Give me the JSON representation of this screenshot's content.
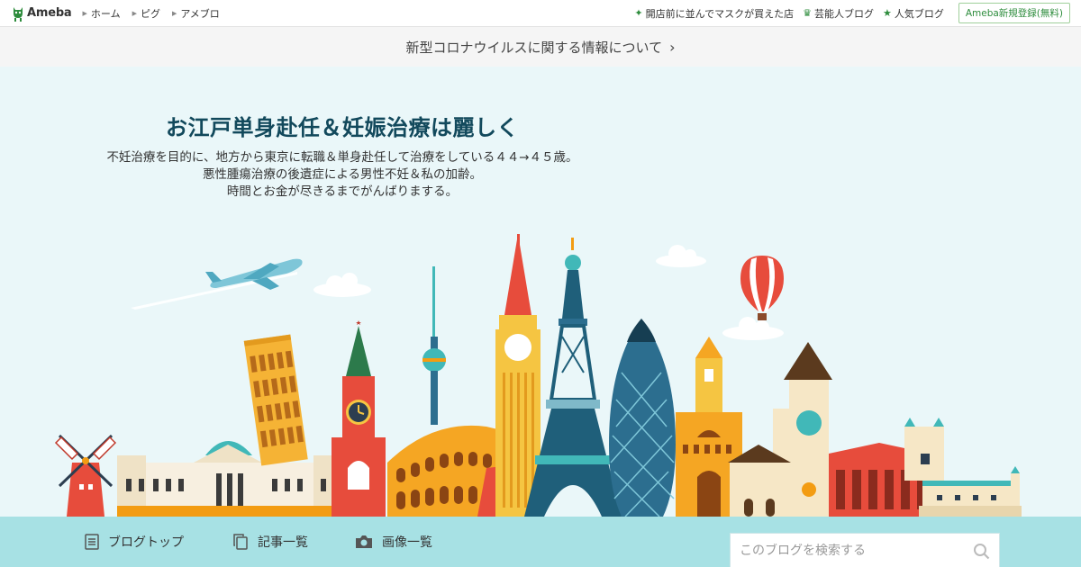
{
  "topbar": {
    "logo_text": "Ameba",
    "left_links": [
      "ホーム",
      "ピグ",
      "アメブロ"
    ],
    "right_links": [
      {
        "label": "開店前に並んでマスクが買えた店",
        "icon": "sparkle-icon"
      },
      {
        "label": "芸能人ブログ",
        "icon": "crown-icon"
      },
      {
        "label": "人気ブログ",
        "icon": "star-icon"
      }
    ],
    "register_label": "Ameba新規登録(無料)"
  },
  "notice": {
    "text": "新型コロナウイルスに関する情報について",
    "chevron": "›"
  },
  "hero": {
    "title": "お江戸単身赴任＆妊娠治療は麗しく",
    "description": [
      "不妊治療を目的に、地方から東京に転職＆単身赴任して治療をしている４４→４５歳。",
      "悪性腫瘍治療の後遺症による男性不妊＆私の加齢。",
      "時間とお金が尽きるまでがんばりまする。"
    ]
  },
  "bottom_nav": {
    "tabs": [
      {
        "label": "ブログトップ",
        "icon": "document-icon"
      },
      {
        "label": "記事一覧",
        "icon": "copy-icon"
      },
      {
        "label": "画像一覧",
        "icon": "camera-icon"
      }
    ],
    "search_placeholder": "このブログを検索する"
  },
  "colors": {
    "accent_green": "#2d8c3c",
    "title_navy": "#12495c",
    "hero_bg": "#eaf7f9",
    "bottom_bg": "#a7e1e4"
  }
}
